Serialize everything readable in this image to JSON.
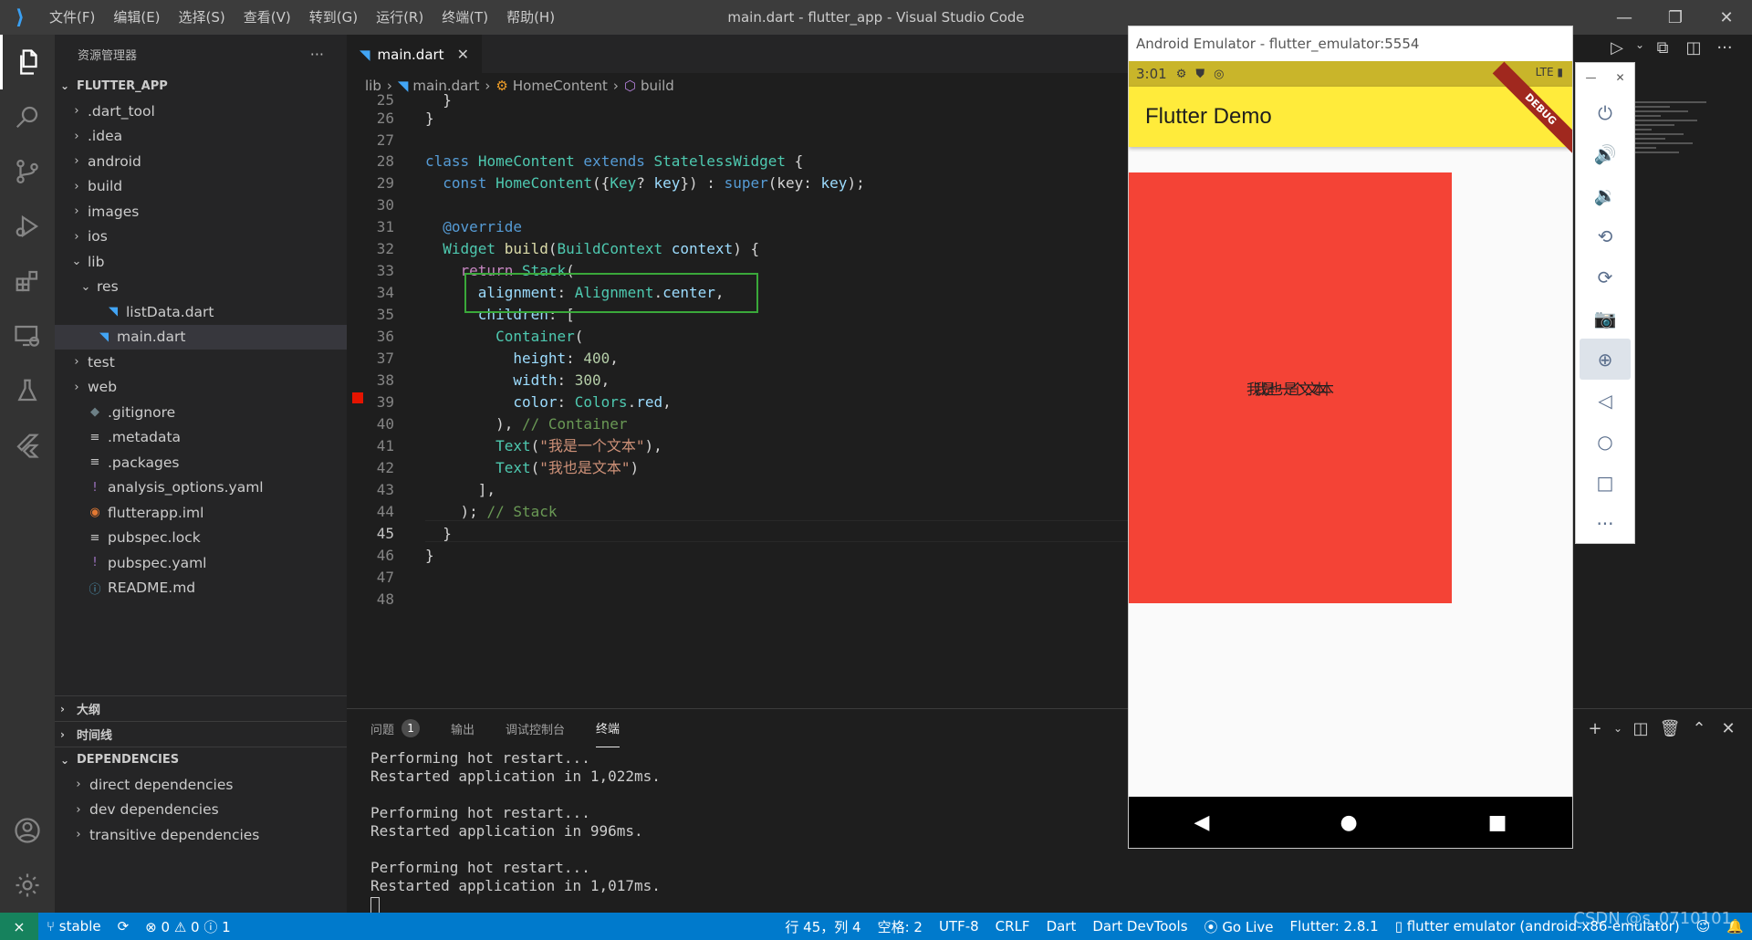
{
  "titlebar": {
    "menu": [
      "文件(F)",
      "编辑(E)",
      "选择(S)",
      "查看(V)",
      "转到(G)",
      "运行(R)",
      "终端(T)",
      "帮助(H)"
    ],
    "window_title": "main.dart - flutter_app - Visual Studio Code"
  },
  "sidebar": {
    "title": "资源管理器",
    "more": "···",
    "project": "FLUTTER_APP",
    "tree": [
      {
        "label": ".dart_tool",
        "type": "folder",
        "indent": 0
      },
      {
        "label": ".idea",
        "type": "folder",
        "indent": 0
      },
      {
        "label": "android",
        "type": "folder",
        "indent": 0
      },
      {
        "label": "build",
        "type": "folder",
        "indent": 0
      },
      {
        "label": "images",
        "type": "folder",
        "indent": 0
      },
      {
        "label": "ios",
        "type": "folder",
        "indent": 0
      },
      {
        "label": "lib",
        "type": "folder-open",
        "indent": 0
      },
      {
        "label": "res",
        "type": "folder-open",
        "indent": 1
      },
      {
        "label": "listData.dart",
        "type": "dart",
        "indent": 2
      },
      {
        "label": "main.dart",
        "type": "dart",
        "indent": 1
      },
      {
        "label": "test",
        "type": "folder",
        "indent": 0
      },
      {
        "label": "web",
        "type": "folder",
        "indent": 0
      },
      {
        "label": ".gitignore",
        "type": "git",
        "indent": 0
      },
      {
        "label": ".metadata",
        "type": "lines",
        "indent": 0
      },
      {
        "label": ".packages",
        "type": "lines",
        "indent": 0
      },
      {
        "label": "analysis_options.yaml",
        "type": "yaml",
        "indent": 0
      },
      {
        "label": "flutterapp.iml",
        "type": "rss",
        "indent": 0
      },
      {
        "label": "pubspec.lock",
        "type": "lines",
        "indent": 0
      },
      {
        "label": "pubspec.yaml",
        "type": "yaml",
        "indent": 0
      },
      {
        "label": "README.md",
        "type": "info",
        "indent": 0
      }
    ],
    "selected_index": 9,
    "outline": "大纲",
    "timeline": "时间线",
    "dependencies": "DEPENDENCIES",
    "dep_items": [
      "direct dependencies",
      "dev dependencies",
      "transitive dependencies"
    ]
  },
  "editor": {
    "tab_label": "main.dart",
    "breadcrumbs": [
      "lib",
      "main.dart",
      "HomeContent",
      "build"
    ],
    "current_line": "45"
  },
  "panel": {
    "tabs": [
      "问题",
      "输出",
      "调试控制台",
      "终端"
    ],
    "problems_count": "1",
    "active_tab": "终端",
    "terminal_lines": [
      "Performing hot restart...",
      "Restarted application in 1,022ms.",
      "",
      "Performing hot restart...",
      "Restarted application in 996ms.",
      "",
      "Performing hot restart...",
      "Restarted application in 1,017ms."
    ]
  },
  "statusbar": {
    "branch": "stable",
    "problems": "⊗ 0 ⚠ 0 ⓘ 1",
    "position": "行 45，列 4",
    "spaces": "空格: 2",
    "encoding": "UTF-8",
    "eol": "CRLF",
    "language": "Dart",
    "devtools": "Dart DevTools",
    "golive": "Go Live",
    "flutter": "Flutter: 2.8.1",
    "device": "flutter emulator (android-x86-emulator)",
    "watermark": "CSDN @s_0710101"
  },
  "emulator": {
    "title": "Android Emulator - flutter_emulator:5554",
    "time": "3:01",
    "network": "LTE",
    "debug_banner": "DEBUG",
    "app_title": "Flutter Demo",
    "text1": "我是一个文本",
    "text2": "我也是文本"
  },
  "colors": {
    "accent": "#007acc",
    "appbar": "#ffeb3b",
    "container": "#f44336",
    "highlight_box": "#3aa83a"
  }
}
